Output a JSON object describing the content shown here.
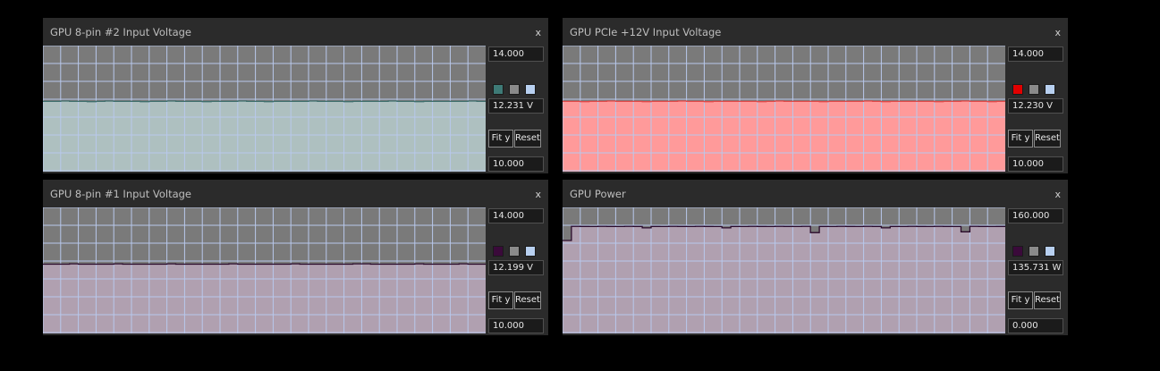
{
  "panels": [
    {
      "id": "p0",
      "title": "GPU 8-pin #2 Input Voltage",
      "close": "x",
      "max": "14.000",
      "min": "10.000",
      "current": "12.231 V",
      "fit_label": "Fit y",
      "reset_label": "Reset",
      "fill_color": "#aec0c0",
      "line_color": "#3e6e6c",
      "swatches": [
        "#3e7a76",
        "#8a8a8a",
        "#b8d0f0"
      ],
      "y_range": [
        10,
        14
      ],
      "series": [
        12.23,
        12.23,
        12.24,
        12.23,
        12.23,
        12.22,
        12.23,
        12.24,
        12.23,
        12.23,
        12.23,
        12.22,
        12.23,
        12.23,
        12.24,
        12.23,
        12.23,
        12.23,
        12.22,
        12.23,
        12.23,
        12.23,
        12.24,
        12.23,
        12.23,
        12.22,
        12.23,
        12.23,
        12.23,
        12.23,
        12.24,
        12.23,
        12.23,
        12.23,
        12.22,
        12.23,
        12.23,
        12.23,
        12.23,
        12.24,
        12.23,
        12.23,
        12.22,
        12.23,
        12.23,
        12.23,
        12.23,
        12.23,
        12.24,
        12.23
      ]
    },
    {
      "id": "p1",
      "title": "GPU PCIe +12V Input Voltage",
      "close": "x",
      "max": "14.000",
      "min": "10.000",
      "current": "12.230 V",
      "fit_label": "Fit y",
      "reset_label": "Reset",
      "fill_color": "#ff9a9a",
      "line_color": "#e04848",
      "swatches": [
        "#e00000",
        "#8a8a8a",
        "#b8d0f0"
      ],
      "y_range": [
        10,
        14
      ],
      "series": [
        12.23,
        12.23,
        12.22,
        12.23,
        12.23,
        12.24,
        12.23,
        12.23,
        12.23,
        12.22,
        12.23,
        12.23,
        12.23,
        12.24,
        12.23,
        12.23,
        12.22,
        12.23,
        12.23,
        12.23,
        12.23,
        12.23,
        12.22,
        12.23,
        12.24,
        12.23,
        12.23,
        12.23,
        12.23,
        12.22,
        12.23,
        12.23,
        12.23,
        12.23,
        12.24,
        12.23,
        12.22,
        12.23,
        12.23,
        12.23,
        12.23,
        12.23,
        12.22,
        12.23,
        12.23,
        12.24,
        12.23,
        12.23,
        12.22,
        12.23
      ]
    },
    {
      "id": "p2",
      "title": "GPU 8-pin #1 Input Voltage",
      "close": "x",
      "max": "14.000",
      "min": "10.000",
      "current": "12.199 V",
      "fit_label": "Fit y",
      "reset_label": "Reset",
      "fill_color": "#b0a0b0",
      "line_color": "#2a0a2a",
      "swatches": [
        "#3a0a3a",
        "#8a8a8a",
        "#b8d0f0"
      ],
      "y_range": [
        10,
        14
      ],
      "series": [
        12.2,
        12.2,
        12.2,
        12.21,
        12.2,
        12.2,
        12.2,
        12.2,
        12.21,
        12.2,
        12.2,
        12.2,
        12.2,
        12.2,
        12.21,
        12.2,
        12.2,
        12.2,
        12.2,
        12.2,
        12.2,
        12.21,
        12.2,
        12.2,
        12.2,
        12.2,
        12.2,
        12.2,
        12.21,
        12.2,
        12.2,
        12.2,
        12.2,
        12.2,
        12.2,
        12.21,
        12.21,
        12.2,
        12.2,
        12.2,
        12.2,
        12.2,
        12.21,
        12.2,
        12.2,
        12.2,
        12.2,
        12.21,
        12.2,
        12.2
      ]
    },
    {
      "id": "p3",
      "title": "GPU Power",
      "close": "x",
      "max": "160.000",
      "min": "0.000",
      "current": "135.731 W",
      "fit_label": "Fit y",
      "reset_label": "Reset",
      "fill_color": "#b0a0b0",
      "line_color": "#2a0a2a",
      "swatches": [
        "#3a0a3a",
        "#8a8a8a",
        "#b8d0f0"
      ],
      "y_range": [
        0,
        160
      ],
      "series": [
        118,
        135.9,
        135.8,
        135.7,
        135.9,
        135.8,
        135.7,
        135.9,
        135.8,
        134,
        135.8,
        135.7,
        135.9,
        135.8,
        135.7,
        135.9,
        135.8,
        135.7,
        134,
        135.8,
        135.7,
        135.9,
        135.8,
        135.7,
        135.9,
        135.8,
        135.7,
        135.9,
        128,
        135.8,
        135.7,
        135.9,
        135.8,
        135.7,
        135.9,
        135.8,
        134,
        135.8,
        135.7,
        135.9,
        135.8,
        135.7,
        135.9,
        135.8,
        135.7,
        129,
        135.9,
        135.8,
        135.7,
        135.8
      ]
    }
  ]
}
